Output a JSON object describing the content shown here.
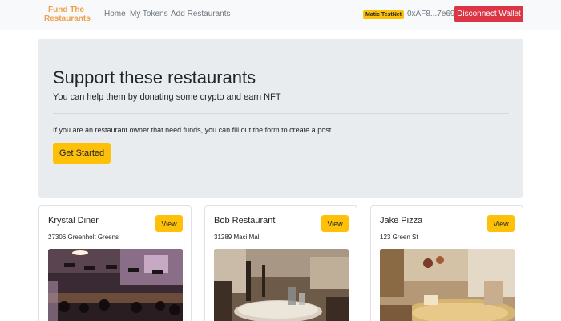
{
  "navbar": {
    "brand": "Fund The Restaurants",
    "links": [
      "Home",
      "My Tokens",
      "Add Restaurants"
    ],
    "network_badge": "Matic TestNet",
    "wallet_address": "0xAF8...7e69f",
    "disconnect_label": "Disconnect Wallet"
  },
  "hero": {
    "title": "Support these restaurants",
    "lead": "You can help them by donating some crypto and earn NFT",
    "note": "If you are an restaurant owner that need funds, you can fill out the form to create a post",
    "cta_label": "Get Started"
  },
  "restaurants": [
    {
      "name": "Krystal Diner",
      "address": "27306 Greenholt Greens",
      "button": "View"
    },
    {
      "name": "Bob Restaurant",
      "address": "31289 Maci Mall",
      "button": "View"
    },
    {
      "name": "Jake Pizza",
      "address": "123 Green St",
      "button": "View"
    }
  ],
  "colors": {
    "brand": "#f0a04b",
    "primary": "#ffc107",
    "danger": "#dc3545",
    "hero_bg": "#e9ecef",
    "navbar_bg": "#f8f9fa"
  }
}
